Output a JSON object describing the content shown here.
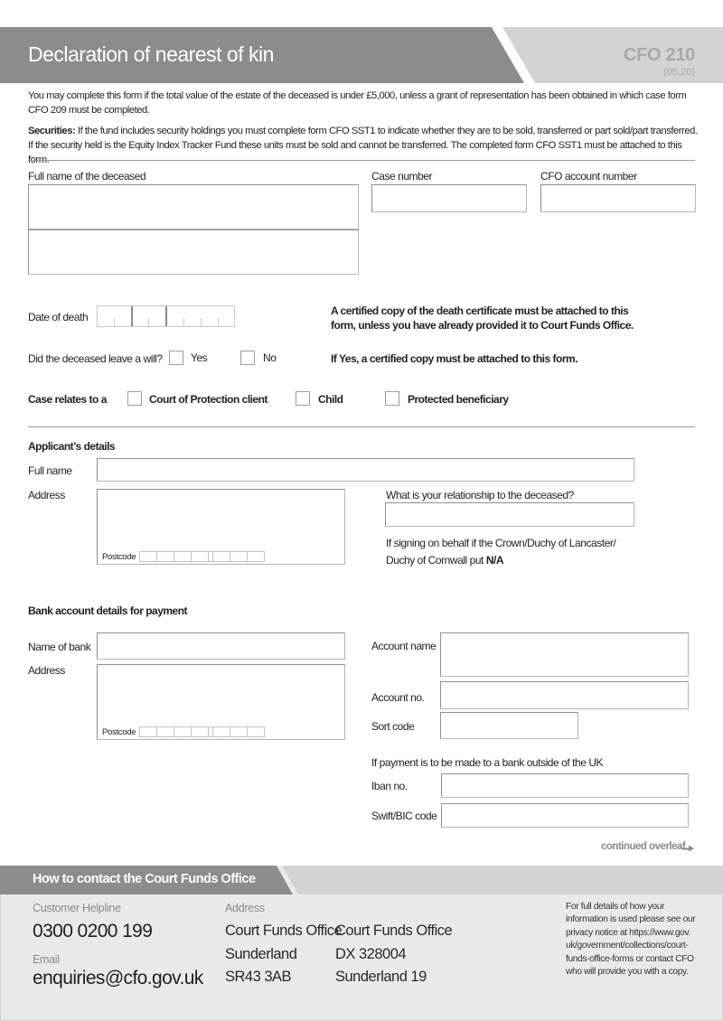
{
  "header": {
    "title": "Declaration of nearest of kin",
    "form_code": "CFO 210",
    "form_date": "(05.20)"
  },
  "intro": {
    "paragraph1_line1": "You may complete this form if the total value of the estate of the deceased is under £5,000, unless a grant of representation has been obtained in which case form",
    "paragraph1_line2": "CFO 209 must be completed.",
    "securities_label": "Securities:",
    "securities_line1": " If the fund includes security holdings you must complete form CFO SST1 to indicate whether they are to be sold, transferred or part sold/part transferred.",
    "securities_line2": "If the security held is the Equity Index Tracker Fund these units must be sold and cannot be transferred. The completed form CFO SST1 must be attached to this form."
  },
  "deceased": {
    "full_name_label": "Full name of the deceased",
    "full_name_line1": "",
    "full_name_line2": "",
    "case_number_label": "Case number",
    "case_number_value": "",
    "cfo_account_label": "CFO account number",
    "cfo_account_value": "",
    "date_of_death_label": "Date of death",
    "date_of_death_value": "",
    "death_cert_note_line1": "A certified copy of the death certificate must be attached to this",
    "death_cert_note_line2": "form, unless you have already provided it to Court Funds Office.",
    "will_question": "Did the deceased leave a will?",
    "will_options": [
      "Yes",
      "No"
    ],
    "will_note": "If Yes, a certified copy must be attached to this form.",
    "case_relates_label": "Case relates to a",
    "case_relates_options": [
      "Court of Protection client",
      "Child",
      "Protected beneficiary"
    ]
  },
  "applicant": {
    "section_title": "Applicant’s details",
    "full_name_label": "Full name",
    "full_name_value": "",
    "address_label": "Address",
    "address_value": "",
    "postcode_label": "Postcode",
    "postcode_value": "",
    "relationship_label": "What is your relationship to the deceased?",
    "relationship_value": "",
    "crown_note_line1": "If signing on behalf if the Crown/Duchy of Lancaster/",
    "crown_note_line2": "Duchy of Cornwall put ",
    "crown_note_na": "N/A"
  },
  "bank": {
    "section_title": "Bank account details for payment",
    "bank_name_label": "Name of bank",
    "bank_name_value": "",
    "address_label": "Address",
    "address_value": "",
    "postcode_label": "Postcode",
    "postcode_value": "",
    "account_name_label": "Account name",
    "account_name_value": "",
    "account_no_label": "Account no.",
    "account_no_value": "",
    "sort_code_label": "Sort code",
    "sort_code_value": "",
    "overseas_note": "If payment is to be made to a bank outside of the UK",
    "iban_label": "Iban no.",
    "iban_value": "",
    "swift_label": "Swift/BIC code",
    "swift_value": ""
  },
  "continued": {
    "label": "continued overleaf",
    "icon": "arrow-right-icon"
  },
  "footer": {
    "title": "How to contact the Court Funds Office",
    "helpline_label": "Customer Helpline",
    "helpline_value": "0300 0200 199",
    "email_label": "Email",
    "email_value": "enquiries@cfo.gov.uk",
    "address_label": "Address",
    "address_col1": [
      "Court Funds Office",
      "Sunderland",
      "SR43 3AB"
    ],
    "address_col2": [
      "Court Funds Office",
      "DX 328004",
      "Sunderland 19"
    ],
    "privacy_lines": [
      "For full details of how your",
      "information is used please see our",
      "privacy notice at https://www.gov.",
      "uk/government/collections/court-",
      "funds-office-forms or contact CFO",
      "who will provide you with a copy."
    ]
  },
  "colors": {
    "header_dark": "#8c8c8c",
    "header_light": "#d3d3d3",
    "footer_bg": "#e9e9e9",
    "muted_text": "#8a8a8a"
  }
}
